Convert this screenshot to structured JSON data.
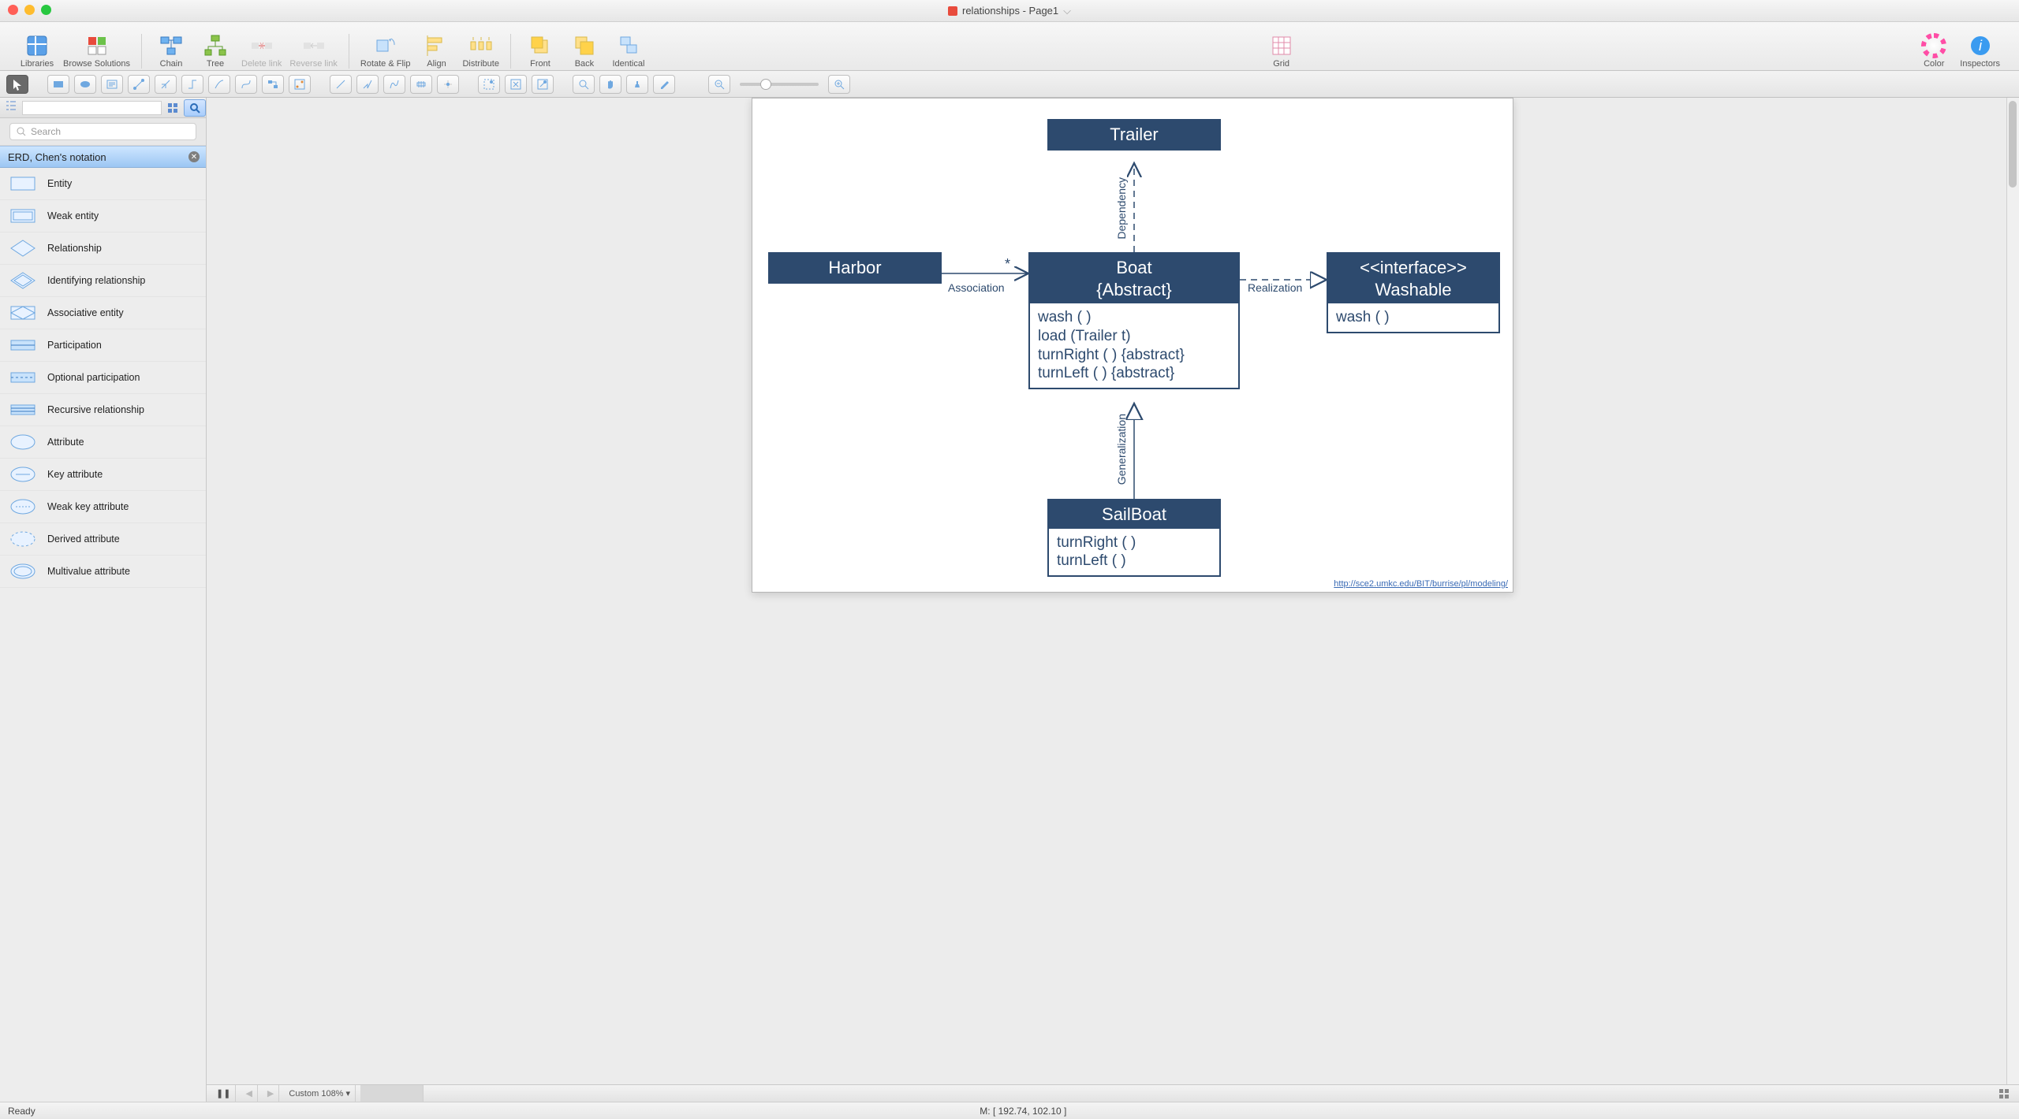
{
  "window": {
    "title": "relationships - Page1"
  },
  "toolbar": {
    "libraries": "Libraries",
    "browse": "Browse Solutions",
    "chain": "Chain",
    "tree": "Tree",
    "delete_link": "Delete link",
    "reverse_link": "Reverse link",
    "rotate_flip": "Rotate & Flip",
    "align": "Align",
    "distribute": "Distribute",
    "front": "Front",
    "back": "Back",
    "identical": "Identical",
    "grid": "Grid",
    "color": "Color",
    "inspectors": "Inspectors"
  },
  "side": {
    "search_placeholder": "Search",
    "category": "ERD, Chen's notation",
    "shapes": [
      "Entity",
      "Weak entity",
      "Relationship",
      "Identifying relationship",
      "Associative entity",
      "Participation",
      "Optional participation",
      "Recursive relationship",
      "Attribute",
      "Key attribute",
      "Weak key attribute",
      "Derived attribute",
      "Multivalue attribute"
    ]
  },
  "diagram": {
    "trailer": {
      "title": "Trailer"
    },
    "harbor": {
      "title": "Harbor"
    },
    "boat": {
      "title1": "Boat",
      "title2": "{Abstract}",
      "ops": [
        "wash ( )",
        "load (Trailer t)",
        "turnRight ( ) {abstract}",
        "turnLeft ( ) {abstract}"
      ]
    },
    "iface": {
      "title1": "<<interface>>",
      "title2": "Washable",
      "ops": [
        "wash ( )"
      ]
    },
    "sailboat": {
      "title": "SailBoat",
      "ops": [
        "turnRight ( )",
        "turnLeft ( )"
      ]
    },
    "labels": {
      "assoc": "Association",
      "star": "*",
      "dep": "Dependency",
      "real": "Realization",
      "gen": "Generalization"
    },
    "link": "http://sce2.umkc.edu/BIT/burrise/pl/modeling/"
  },
  "pagestrip": {
    "zoom": "Custom 108%"
  },
  "status": {
    "left": "Ready",
    "mouse": "M: [ 192.74, 102.10 ]"
  }
}
